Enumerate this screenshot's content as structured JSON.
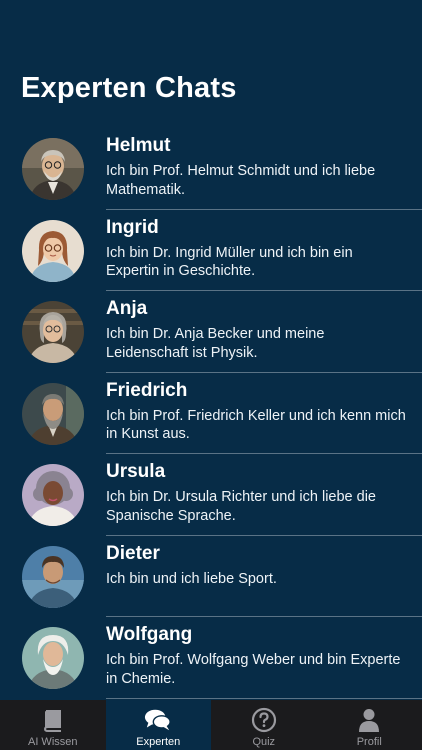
{
  "header": {
    "title": "Experten Chats"
  },
  "experts": [
    {
      "name": "Helmut",
      "description": "Ich bin Prof. Helmut Schmidt und ich liebe Mathematik.",
      "avatar_icon": "professor-portrait"
    },
    {
      "name": "Ingrid",
      "description": "Ich bin Dr. Ingrid Müller und ich bin ein Expertin in Geschichte.",
      "avatar_icon": "woman-glasses-portrait"
    },
    {
      "name": "Anja",
      "description": "Ich bin Dr. Anja Becker und meine Leidenschaft ist Physik.",
      "avatar_icon": "woman-grey-hair-portrait"
    },
    {
      "name": "Friedrich",
      "description": "Ich bin Prof. Friedrich Keller und ich kenn mich in Kunst aus.",
      "avatar_icon": "bearded-man-portrait"
    },
    {
      "name": "Ursula",
      "description": "Ich bin Dr. Ursula Richter und ich liebe die Spanische Sprache.",
      "avatar_icon": "woman-curly-hair-portrait"
    },
    {
      "name": "Dieter",
      "description": "Ich bin und ich liebe Sport.",
      "avatar_icon": "young-man-portrait"
    },
    {
      "name": "Wolfgang",
      "description": "Ich bin Prof. Wolfgang Weber und bin Experte in Chemie.",
      "avatar_icon": "old-man-white-hair-portrait"
    }
  ],
  "tabbar": {
    "tabs": [
      {
        "label": "AI Wissen",
        "icon": "book-icon",
        "active": false
      },
      {
        "label": "Experten",
        "icon": "chat-bubbles-icon",
        "active": true
      },
      {
        "label": "Quiz",
        "icon": "question-circle-icon",
        "active": false
      },
      {
        "label": "Profil",
        "icon": "person-icon",
        "active": false
      }
    ]
  },
  "colors": {
    "background": "#072c47",
    "tabbar": "#1b1b1d",
    "separator": "#5a7386"
  }
}
